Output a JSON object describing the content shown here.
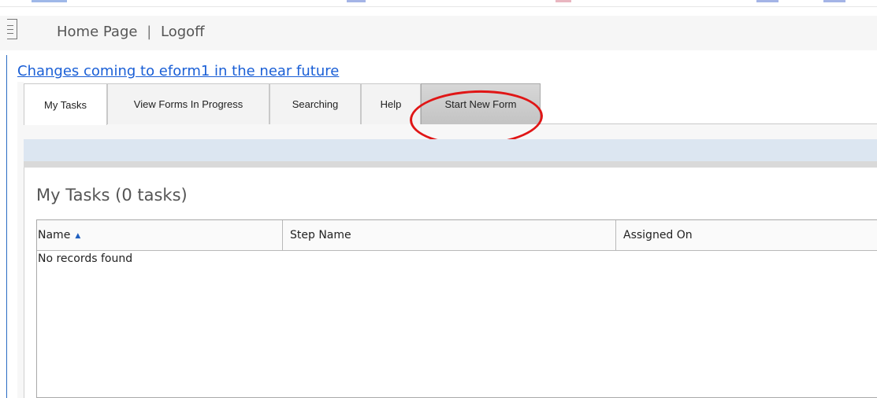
{
  "top_nav": {
    "home_label": "Home Page",
    "separator": "|",
    "logoff_label": "Logoff"
  },
  "announcement": {
    "text": "Changes coming to eform1 in the near future"
  },
  "tabs": [
    {
      "label": "My Tasks",
      "active": true
    },
    {
      "label": "View Forms In Progress",
      "active": false
    },
    {
      "label": "Searching",
      "active": false
    },
    {
      "label": "Help",
      "active": false
    },
    {
      "label": "Start New Form",
      "active": false,
      "highlighted": true
    }
  ],
  "tasks": {
    "title": "My Tasks (0 tasks)",
    "columns": [
      "Name",
      "Step Name",
      "Assigned On"
    ],
    "sort_indicator": "▲",
    "empty_message": "No records found"
  },
  "icons": {
    "menu": "hamburger-menu-icon",
    "sort": "sort-ascending-icon"
  },
  "colors": {
    "link": "#1a5fd6",
    "callout": "#e01616",
    "toolbar_band": "#dce6f1"
  }
}
